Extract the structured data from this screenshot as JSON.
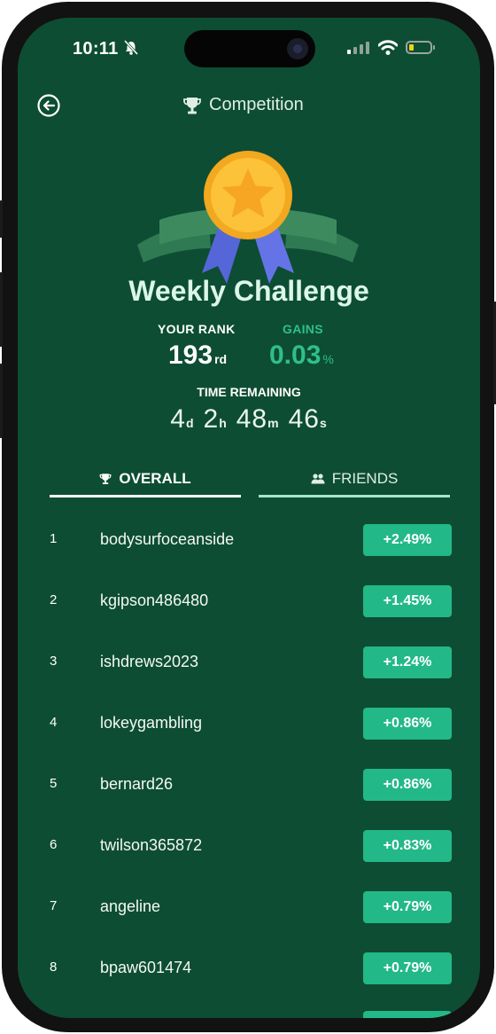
{
  "status_bar": {
    "time": "10:11"
  },
  "header": {
    "title": "Competition",
    "back_icon": "back-arrow-icon",
    "trophy_icon": "trophy-icon"
  },
  "challenge": {
    "title": "Weekly Challenge",
    "rank_label": "YOUR RANK",
    "rank_value": "193",
    "rank_suffix": "rd",
    "gains_label": "GAINS",
    "gains_value": "0.03",
    "gains_suffix": "%",
    "time_label": "TIME REMAINING",
    "timer": {
      "d": "4",
      "d_unit": "d",
      "h": "2",
      "h_unit": "h",
      "m": "48",
      "m_unit": "m",
      "s": "46",
      "s_unit": "s"
    }
  },
  "tabs": {
    "overall": "OVERALL",
    "friends": "FRIENDS"
  },
  "leaderboard": [
    {
      "rank": "1",
      "name": "bodysurfoceanside",
      "gain": "+2.49%"
    },
    {
      "rank": "2",
      "name": "kgipson486480",
      "gain": "+1.45%"
    },
    {
      "rank": "3",
      "name": "ishdrews2023",
      "gain": "+1.24%"
    },
    {
      "rank": "4",
      "name": "lokeygambling",
      "gain": "+0.86%"
    },
    {
      "rank": "5",
      "name": "bernard26",
      "gain": "+0.86%"
    },
    {
      "rank": "6",
      "name": "twilson365872",
      "gain": "+0.83%"
    },
    {
      "rank": "7",
      "name": "angeline",
      "gain": "+0.79%"
    },
    {
      "rank": "8",
      "name": "bpaw601474",
      "gain": "+0.79%"
    }
  ],
  "colors": {
    "background": "#0d4d34",
    "accent": "#23b887",
    "gains_text": "#2fbf8a",
    "title_text": "#dcf6ea"
  }
}
